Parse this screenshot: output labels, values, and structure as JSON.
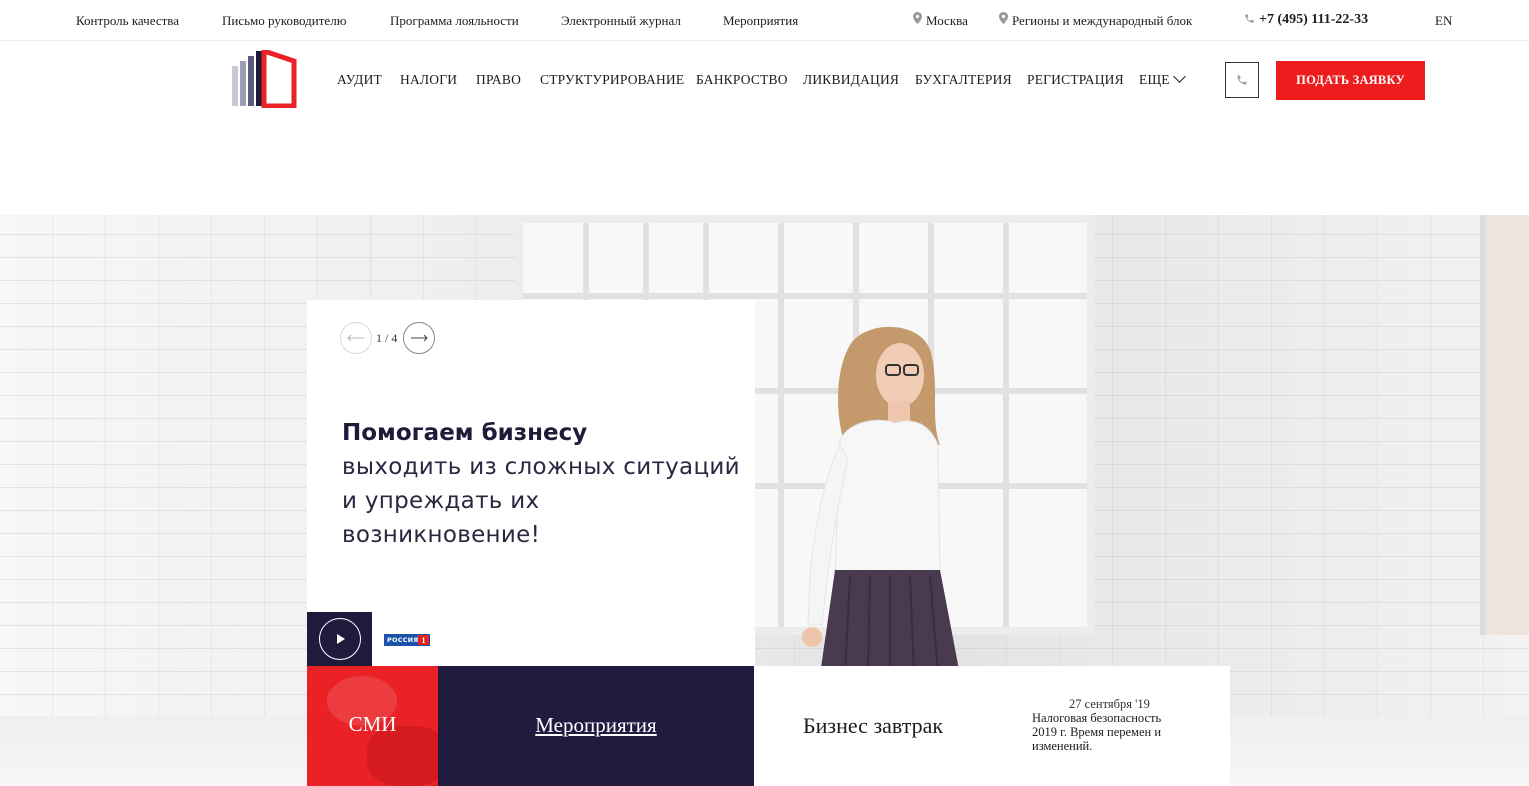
{
  "topbar": {
    "links": [
      "Контроль качества",
      "Письмо руководителю",
      "Программа лояльности",
      "Электронный журнал",
      "Мероприятия"
    ],
    "city": "Москва",
    "regions": "Регионы и международный блок",
    "phone": "+7 (495) 111-22-33",
    "lang": "EN"
  },
  "nav": {
    "items": [
      "АУДИТ",
      "НАЛОГИ",
      "ПРАВО",
      "СТРУКТУРИРОВАНИЕ",
      "БАНКРОСТВО",
      "ЛИКВИДАЦИЯ",
      "БУХГАЛТЕРИЯ",
      "РЕГИСТРАЦИЯ"
    ],
    "more": "ЕЩЕ",
    "apply_label": "ПОДАТЬ ЗАЯВКУ"
  },
  "slider": {
    "counter": "1 / 4",
    "headline_bold": "Помогаем бизнесу",
    "headline_lines": [
      "выходить из сложных ситуаций",
      "и упреждать их",
      "возникновение!"
    ],
    "tv_channel": "РОССИЯ",
    "tv_channel_number": "1"
  },
  "tiles": {
    "smi": "СМИ",
    "events": "Мероприятия",
    "breakfast": "Бизнес завтрак",
    "event_date": "27 сентября '19",
    "event_desc": "Налоговая безопасность 2019 г. Время перемен и изменений."
  },
  "colors": {
    "accent_red": "#ee1c1c",
    "navy": "#221b40"
  }
}
